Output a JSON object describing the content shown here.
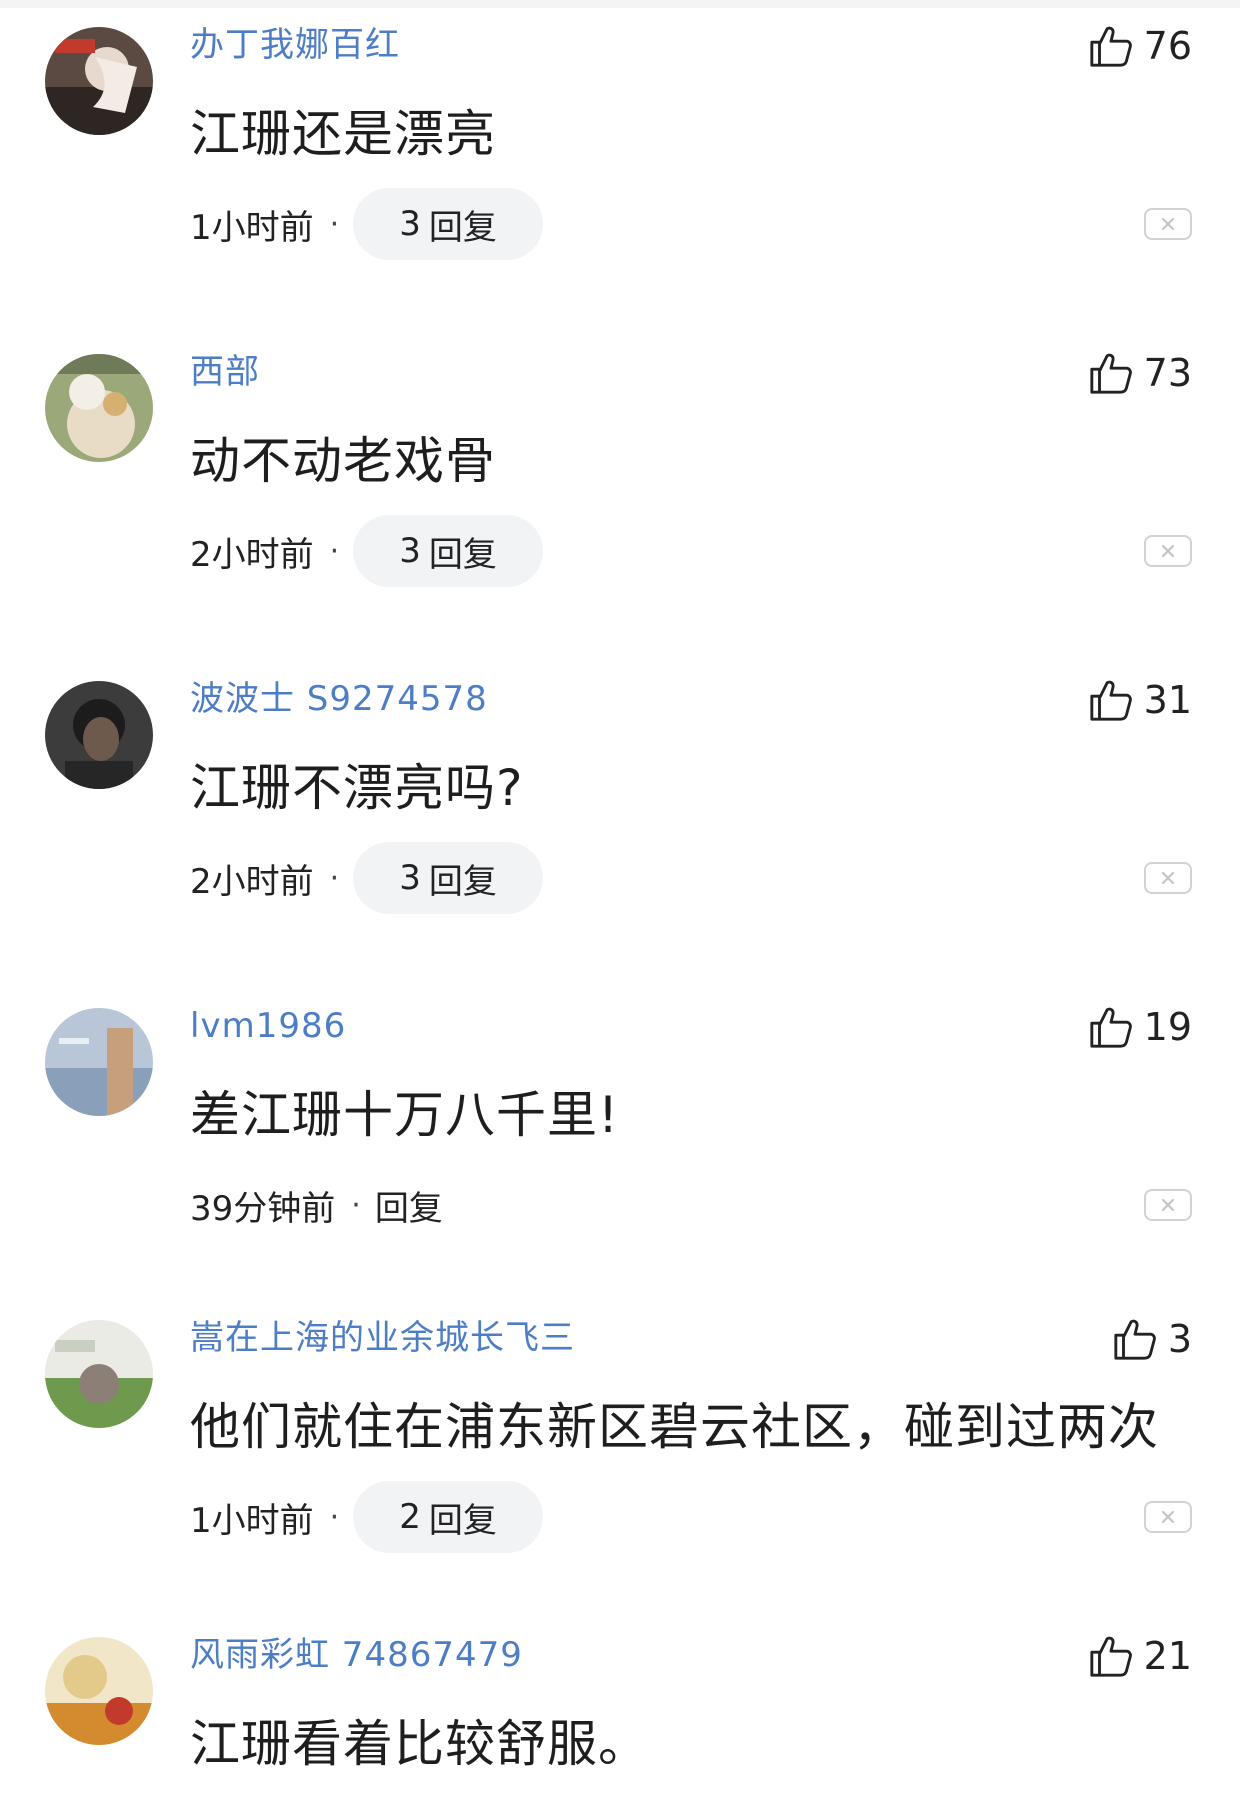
{
  "comments": [
    {
      "username": "办丁我娜百红",
      "likes": "76",
      "text": "江珊还是漂亮",
      "time": "1小时前",
      "reply_count": "3",
      "reply_label": "回复"
    },
    {
      "username": "西部",
      "likes": "73",
      "text": "动不动老戏骨",
      "time": "2小时前",
      "reply_count": "3",
      "reply_label": "回复"
    },
    {
      "username": "波波士 S9274578",
      "likes": "31",
      "text": "江珊不漂亮吗?",
      "time": "2小时前",
      "reply_count": "3",
      "reply_label": "回复"
    },
    {
      "username": "lvm1986",
      "likes": "19",
      "text": "差江珊十万八千里!",
      "time": "39分钟前",
      "reply_count": "",
      "reply_label": "回复"
    },
    {
      "username": "嵩在上海的业余城长飞三",
      "likes": "3",
      "text": "他们就住在浦东新区碧云社区，碰到过两次",
      "time": "1小时前",
      "reply_count": "2",
      "reply_label": "回复"
    },
    {
      "username": "风雨彩虹 74867479",
      "likes": "21",
      "text": "江珊看着比较舒服。",
      "time": "",
      "reply_count": "",
      "reply_label": ""
    }
  ],
  "icons": {
    "like": "thumbs-up-icon",
    "dismiss": "close-icon"
  },
  "colors": {
    "username": "#3a6fbf",
    "pill": "#f2f3f5",
    "text": "#1e1e1e"
  }
}
